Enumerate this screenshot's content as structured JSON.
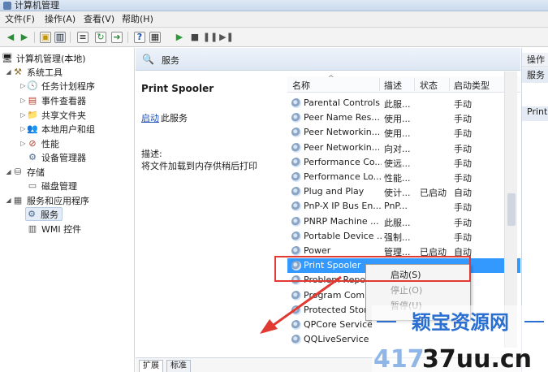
{
  "window": {
    "title": "计算机管理"
  },
  "menu": [
    "文件(F)",
    "操作(A)",
    "查看(V)",
    "帮助(H)"
  ],
  "tree": {
    "root": "计算机管理(本地)",
    "system_tools": "系统工具",
    "system_children": [
      "任务计划程序",
      "事件查看器",
      "共享文件夹",
      "本地用户和组",
      "性能",
      "设备管理器"
    ],
    "storage": "存储",
    "storage_children": [
      "磁盘管理"
    ],
    "services_apps": "服务和应用程序",
    "services_children": [
      "服务",
      "WMI 控件"
    ]
  },
  "center": {
    "header": "服务",
    "selected_service": "Print Spooler",
    "start_link": "启动",
    "start_rest": "此服务",
    "desc_label": "描述:",
    "desc_text": "将文件加载到内存供稍后打印"
  },
  "columns": {
    "name": "名称",
    "desc": "描述",
    "status": "状态",
    "startup": "启动类型"
  },
  "services": [
    {
      "name": "Parental Controls",
      "desc": "此服...",
      "status": "",
      "startup": "手动"
    },
    {
      "name": "Peer Name Res...",
      "desc": "使用...",
      "status": "",
      "startup": "手动"
    },
    {
      "name": "Peer Networkin...",
      "desc": "使用...",
      "status": "",
      "startup": "手动"
    },
    {
      "name": "Peer Networkin...",
      "desc": "向对...",
      "status": "",
      "startup": "手动"
    },
    {
      "name": "Performance Co...",
      "desc": "使远...",
      "status": "",
      "startup": "手动"
    },
    {
      "name": "Performance Lo...",
      "desc": "性能...",
      "status": "",
      "startup": "手动"
    },
    {
      "name": "Plug and Play",
      "desc": "使计...",
      "status": "已启动",
      "startup": "自动"
    },
    {
      "name": "PnP-X IP Bus En...",
      "desc": "PnP...",
      "status": "",
      "startup": "手动"
    },
    {
      "name": "PNRP Machine ...",
      "desc": "此服...",
      "status": "",
      "startup": "手动"
    },
    {
      "name": "Portable Device ...",
      "desc": "强制...",
      "status": "",
      "startup": "手动"
    },
    {
      "name": "Power",
      "desc": "管理...",
      "status": "已启动",
      "startup": "自动"
    },
    {
      "name": "Print Spooler",
      "desc": "",
      "status": "",
      "startup": ""
    },
    {
      "name": "Problem Repo...",
      "desc": "",
      "status": "",
      "startup": ""
    },
    {
      "name": "Program Comp...",
      "desc": "",
      "status": "",
      "startup": ""
    },
    {
      "name": "Protected Stor...",
      "desc": "",
      "status": "",
      "startup": ""
    },
    {
      "name": "QPCore Service",
      "desc": "",
      "status": "",
      "startup": ""
    },
    {
      "name": "QQLiveService",
      "desc": "",
      "status": "",
      "startup": ""
    }
  ],
  "context_menu": {
    "items": [
      "启动(S)",
      "停止(O)",
      "暂停(U)"
    ]
  },
  "tabs": [
    "扩展",
    "标准"
  ],
  "actions": {
    "header": "操作",
    "group": "服务",
    "item": "Print"
  },
  "watermark": {
    "line1": "颖宝资源网",
    "line2_a": "417",
    "line2_b": "37uu.cn"
  },
  "colors": {
    "selection": "#3399ff",
    "annotation": "#e03a33",
    "watermark_blue": "#2a6fd0"
  }
}
